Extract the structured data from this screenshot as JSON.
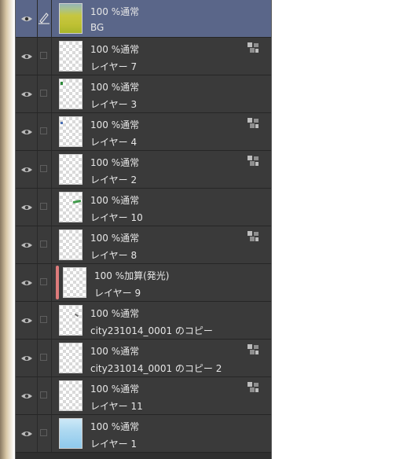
{
  "layers_panel": {
    "layers": [
      {
        "blend": "100 %通常",
        "name": "BG",
        "selected": true,
        "editing": true,
        "thumb": "bg",
        "clip": false
      },
      {
        "blend": "100 %通常",
        "name": "レイヤー 7",
        "selected": false,
        "editing": false,
        "thumb": "transparent",
        "clip": true
      },
      {
        "blend": "100 %通常",
        "name": "レイヤー 3",
        "selected": false,
        "editing": false,
        "thumb": "transparent",
        "clip": false
      },
      {
        "blend": "100 %通常",
        "name": "レイヤー 4",
        "selected": false,
        "editing": false,
        "thumb": "transparent",
        "clip": true
      },
      {
        "blend": "100 %通常",
        "name": "レイヤー 2",
        "selected": false,
        "editing": false,
        "thumb": "transparent",
        "clip": true
      },
      {
        "blend": "100 %通常",
        "name": "レイヤー 10",
        "selected": false,
        "editing": false,
        "thumb": "transparent",
        "clip": false
      },
      {
        "blend": "100 %通常",
        "name": "レイヤー 8",
        "selected": false,
        "editing": false,
        "thumb": "transparent",
        "clip": true
      },
      {
        "blend": "100 %加算(発光)",
        "name": "レイヤー 9",
        "selected": false,
        "editing": false,
        "thumb": "transparent",
        "clip": false,
        "color_tag": "#dd7b7b"
      },
      {
        "blend": "100 %通常",
        "name": "city231014_0001 のコピー",
        "selected": false,
        "editing": false,
        "thumb": "transparent",
        "clip": false
      },
      {
        "blend": "100 %通常",
        "name": "city231014_0001 のコピー 2",
        "selected": false,
        "editing": false,
        "thumb": "transparent",
        "clip": true
      },
      {
        "blend": "100 %通常",
        "name": "レイヤー 11",
        "selected": false,
        "editing": false,
        "thumb": "transparent",
        "clip": true
      },
      {
        "blend": "100 %通常",
        "name": "レイヤー 1",
        "selected": false,
        "editing": false,
        "thumb": "sky",
        "clip": false
      }
    ]
  },
  "colors": {
    "panel_bg": "#3a3a3a",
    "selected_row": "#5a6689",
    "text": "#e6e6e6",
    "color_tag": "#dd7b7b"
  }
}
